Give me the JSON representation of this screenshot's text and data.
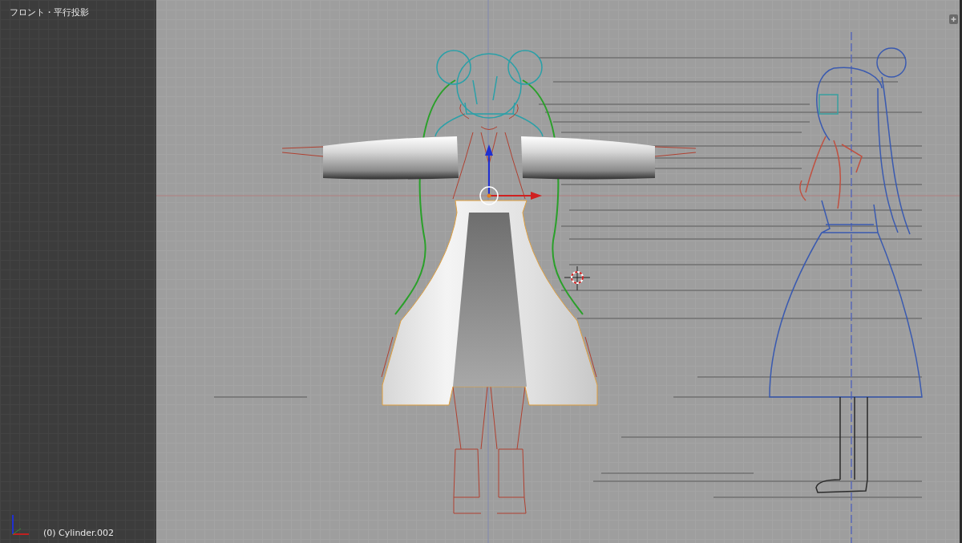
{
  "viewport": {
    "view_label": "フロント・平行投影",
    "object_label": "(0) Cylinder.002"
  }
}
